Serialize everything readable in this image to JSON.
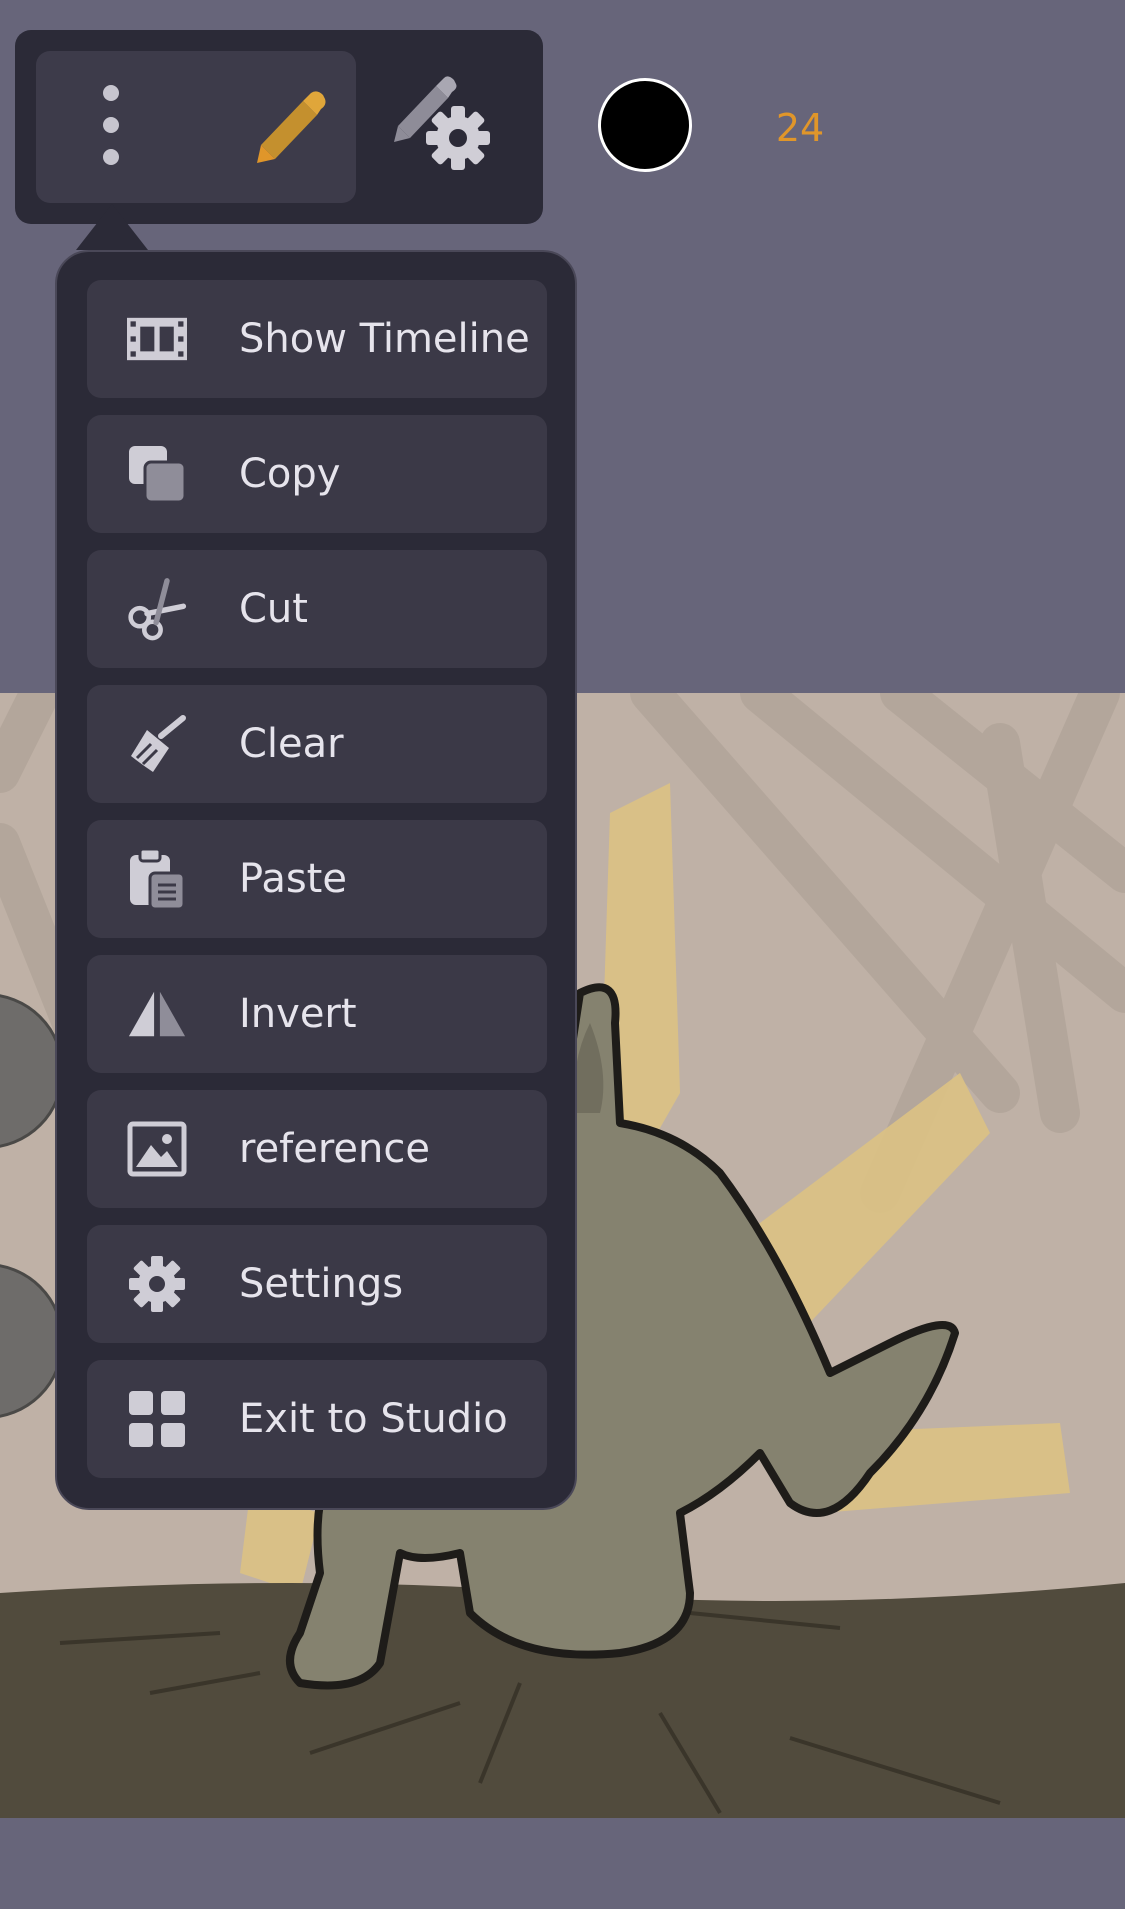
{
  "toolbar": {
    "more_icon": "vertical-ellipsis-icon",
    "pencil_icon": "pencil-icon",
    "brush_settings_icon": "pencil-gear-icon",
    "color": "#000000",
    "brush_size": "24",
    "accent_color": "#e0962a"
  },
  "menu": {
    "items": [
      {
        "label": "Show Timeline",
        "icon": "film-strip-icon"
      },
      {
        "label": "Copy",
        "icon": "copy-icon"
      },
      {
        "label": "Cut",
        "icon": "scissors-icon"
      },
      {
        "label": "Clear",
        "icon": "broom-icon"
      },
      {
        "label": "Paste",
        "icon": "clipboard-icon"
      },
      {
        "label": "Invert",
        "icon": "flip-icon"
      },
      {
        "label": "reference",
        "icon": "image-icon"
      },
      {
        "label": "Settings",
        "icon": "gear-icon"
      },
      {
        "label": "Exit to Studio",
        "icon": "grid-icon"
      }
    ]
  }
}
